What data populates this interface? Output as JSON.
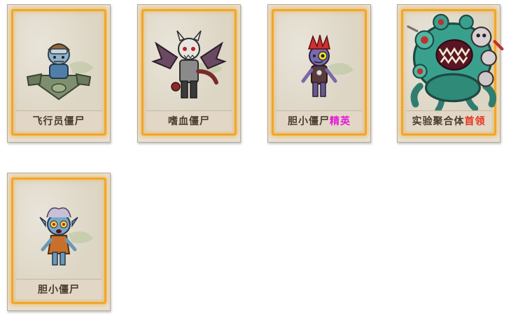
{
  "cards": [
    {
      "name": "飞行员僵尸",
      "rank": "",
      "icon": "pilot-zombie-portrait"
    },
    {
      "name": "嗜血僵尸",
      "rank": "",
      "icon": "bloodthirsty-zombie-portrait"
    },
    {
      "name": "胆小僵尸",
      "rank": "精英",
      "icon": "timid-zombie-elite-portrait"
    },
    {
      "name": "实验聚合体",
      "rank": "首领",
      "icon": "experimental-aggregate-boss-portrait"
    },
    {
      "name": "胆小僵尸",
      "rank": "",
      "icon": "timid-zombie-portrait"
    }
  ],
  "colors": {
    "frame": "#f2a62a",
    "elite": "#e21ad6",
    "boss": "#e8321a",
    "name_text": "#4a3c2c"
  }
}
